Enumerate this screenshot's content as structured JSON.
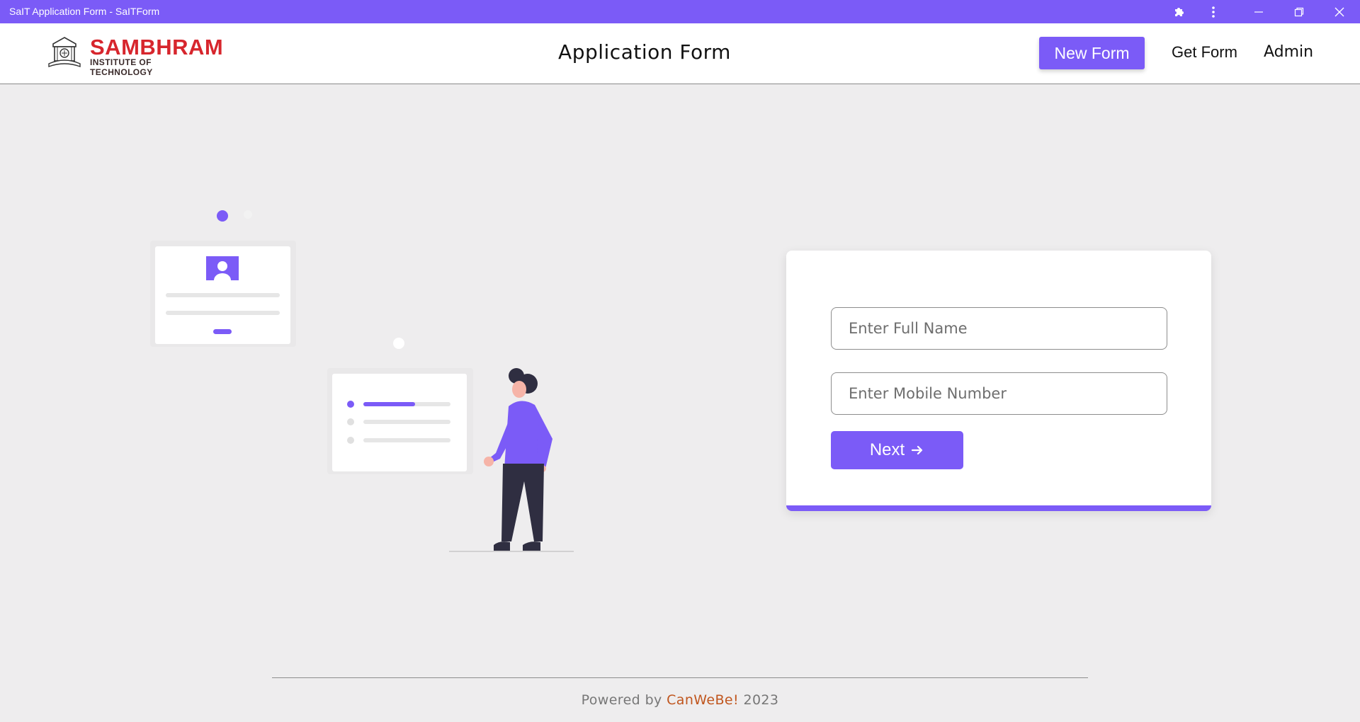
{
  "window": {
    "title": "SaIT Application Form - SaITForm"
  },
  "header": {
    "logo_name": "SAMBHRAM",
    "logo_subtitle": "INSTITUTE OF TECHNOLOGY",
    "page_title": "Application Form",
    "nav": {
      "new_form": "New Form",
      "get_form": "Get Form",
      "admin": "Admin"
    }
  },
  "form": {
    "full_name_placeholder": "Enter Full Name",
    "full_name_value": "",
    "mobile_placeholder": "Enter Mobile Number",
    "mobile_value": "",
    "next_label": "Next",
    "next_icon": "arrow-right-icon"
  },
  "footer": {
    "prefix": "Powered by",
    "brand": "CanWeBe!",
    "year": "2023"
  },
  "colors": {
    "accent": "#7b5bf7",
    "brand_red": "#d7262d",
    "footer_brand": "#c0561e",
    "background": "#eeedee"
  }
}
